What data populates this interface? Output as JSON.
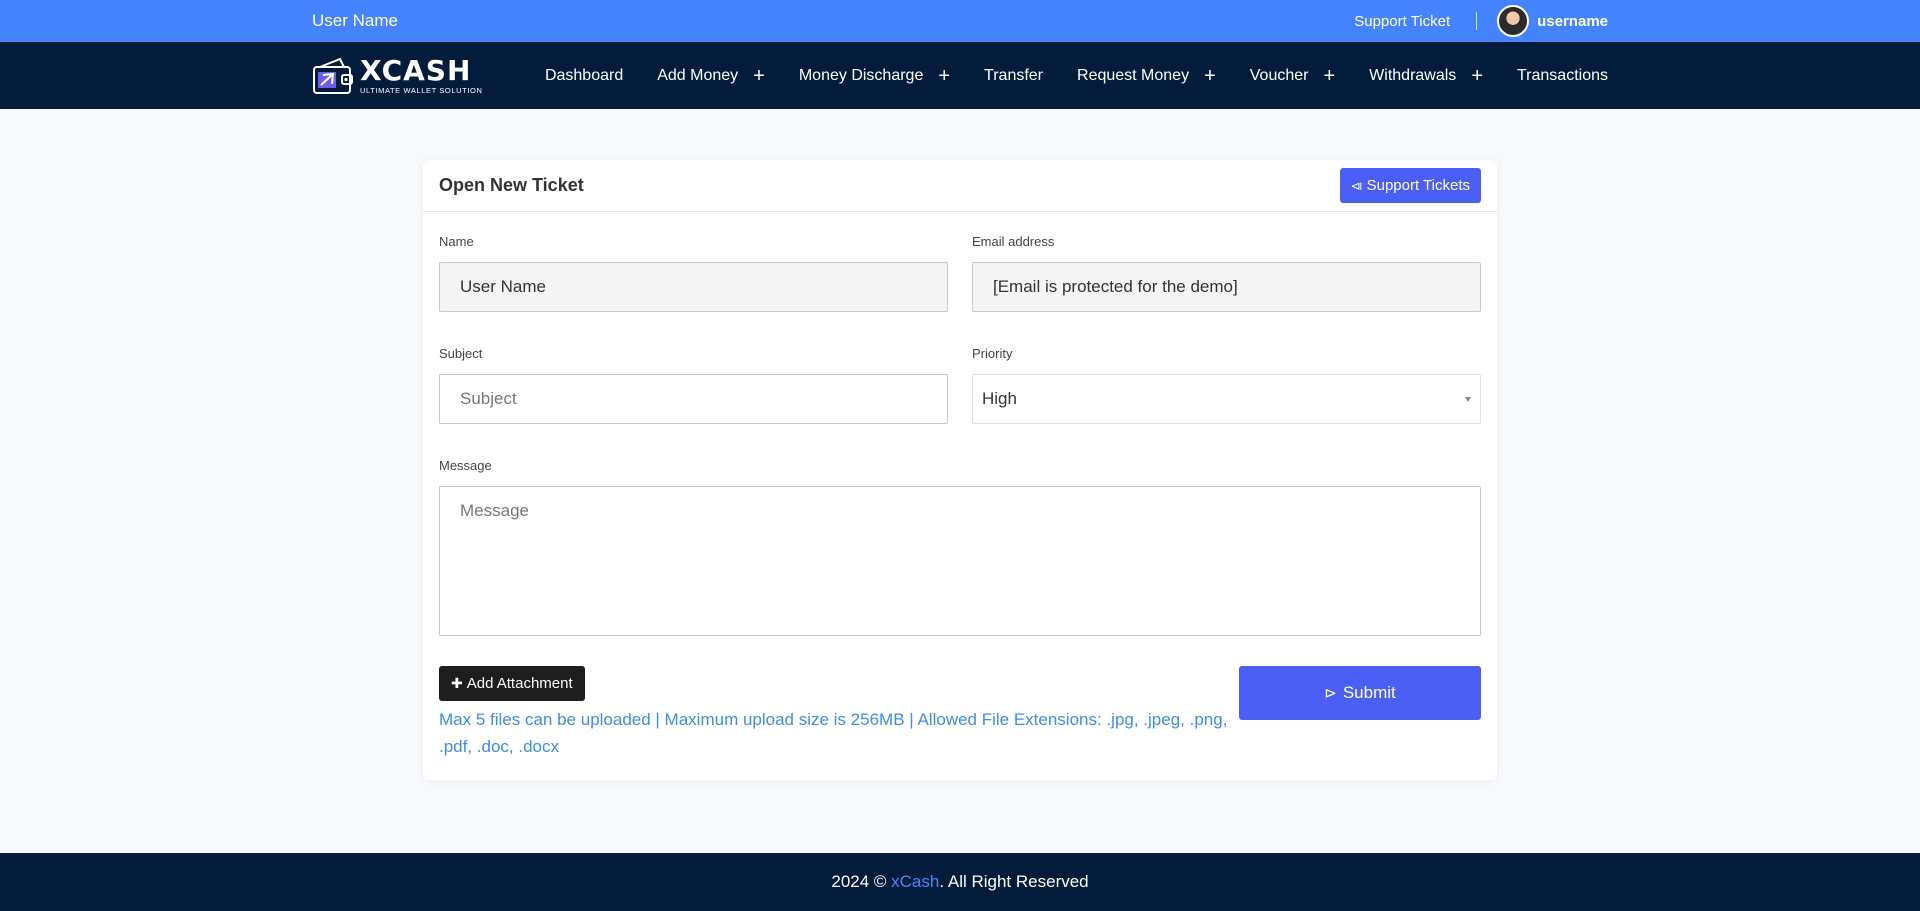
{
  "topbar": {
    "user_name": "User Name",
    "support_link": "Support Ticket",
    "username": "username"
  },
  "navbar": {
    "logo_title": "XCASH",
    "logo_tagline": "ULTIMATE WALLET SOLUTION",
    "items": [
      {
        "label": "Dashboard",
        "has_submenu": false
      },
      {
        "label": "Add Money",
        "has_submenu": true
      },
      {
        "label": "Money Discharge",
        "has_submenu": true
      },
      {
        "label": "Transfer",
        "has_submenu": false
      },
      {
        "label": "Request Money",
        "has_submenu": true
      },
      {
        "label": "Voucher",
        "has_submenu": true
      },
      {
        "label": "Withdrawals",
        "has_submenu": true
      },
      {
        "label": "Transactions",
        "has_submenu": false
      }
    ],
    "submenu_icon": "+"
  },
  "card": {
    "title": "Open New Ticket",
    "support_tickets_button": "Support Tickets",
    "support_tickets_icon": "⧏",
    "name_label": "Name",
    "name_value": "User Name",
    "email_label": "Email address",
    "email_value": "[Email is protected for the demo]",
    "subject_label": "Subject",
    "subject_placeholder": "Subject",
    "priority_label": "Priority",
    "priority_value": "High",
    "message_label": "Message",
    "message_placeholder": "Message",
    "add_attachment_button": "Add Attachment",
    "add_attachment_icon": "✚",
    "attachment_note": "Max 5 files can be uploaded | Maximum upload size is 256MB | Allowed File Extensions: .jpg, .jpeg, .png, .pdf, .doc, .docx",
    "submit_button": "Submit",
    "submit_icon": "⊳"
  },
  "footer": {
    "prefix": "2024 © ",
    "brand": "xCash",
    "suffix": ". All Right Reserved"
  },
  "colors": {
    "topbar": "#4684ff",
    "navbar": "#041c3c",
    "primary_button": "#4c5ff5",
    "note_text": "#3e8fdc"
  }
}
